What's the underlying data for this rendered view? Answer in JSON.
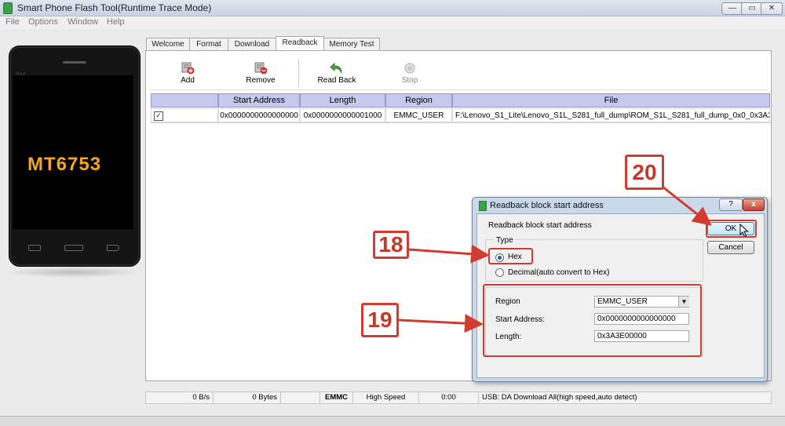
{
  "window": {
    "title": "Smart Phone Flash Tool(Runtime Trace Mode)",
    "controls": [
      "—",
      "▭",
      "✕"
    ]
  },
  "menu": [
    "File",
    "Options",
    "Window",
    "Help"
  ],
  "phone": {
    "chip": "MT6753",
    "brand": "BM"
  },
  "tabs": [
    "Welcome",
    "Format",
    "Download",
    "Readback",
    "Memory Test"
  ],
  "active_tab": "Readback",
  "toolbar": {
    "add": "Add",
    "remove": "Remove",
    "readback": "Read Back",
    "stop": "Stop"
  },
  "table": {
    "columns": [
      "",
      "Start Address",
      "Length",
      "Region",
      "File"
    ],
    "rows": [
      {
        "checked": "✓",
        "start": "0x0000000000000000",
        "length": "0x0000000000001000",
        "region": "EMMC_USER",
        "file": "F:\\Lenovo_S1_Lite\\Lenovo_S1L_S281_full_dump\\ROM_S1L_S281_full_dump_0x0_0x3A3E..."
      }
    ]
  },
  "status": {
    "speed": "0 B/s",
    "bytes": "0 Bytes",
    "storage": "EMMC",
    "mode": "High Speed",
    "time": "0:00",
    "usb": "USB: DA Download All(high speed,auto detect)"
  },
  "dialog": {
    "title": "Readback block start address",
    "help": "?",
    "close": "x",
    "heading": "Readback block start address",
    "type_label": "Type",
    "hex_label": "Hex",
    "decimal_label": "Decimal(auto convert to Hex)",
    "region_label": "Region",
    "region_value": "EMMC_USER",
    "start_label": "Start Address:",
    "start_value": "0x0000000000000000",
    "length_label": "Length:",
    "length_value": "0x3A3E00000",
    "ok": "OK",
    "cancel": "Cancel"
  },
  "annotations": {
    "a18": "18",
    "a19": "19",
    "a20": "20"
  },
  "colors": {
    "annotation": "#d13b30",
    "chip_text": "#f5a623",
    "table_header": "#c8c8ef"
  }
}
